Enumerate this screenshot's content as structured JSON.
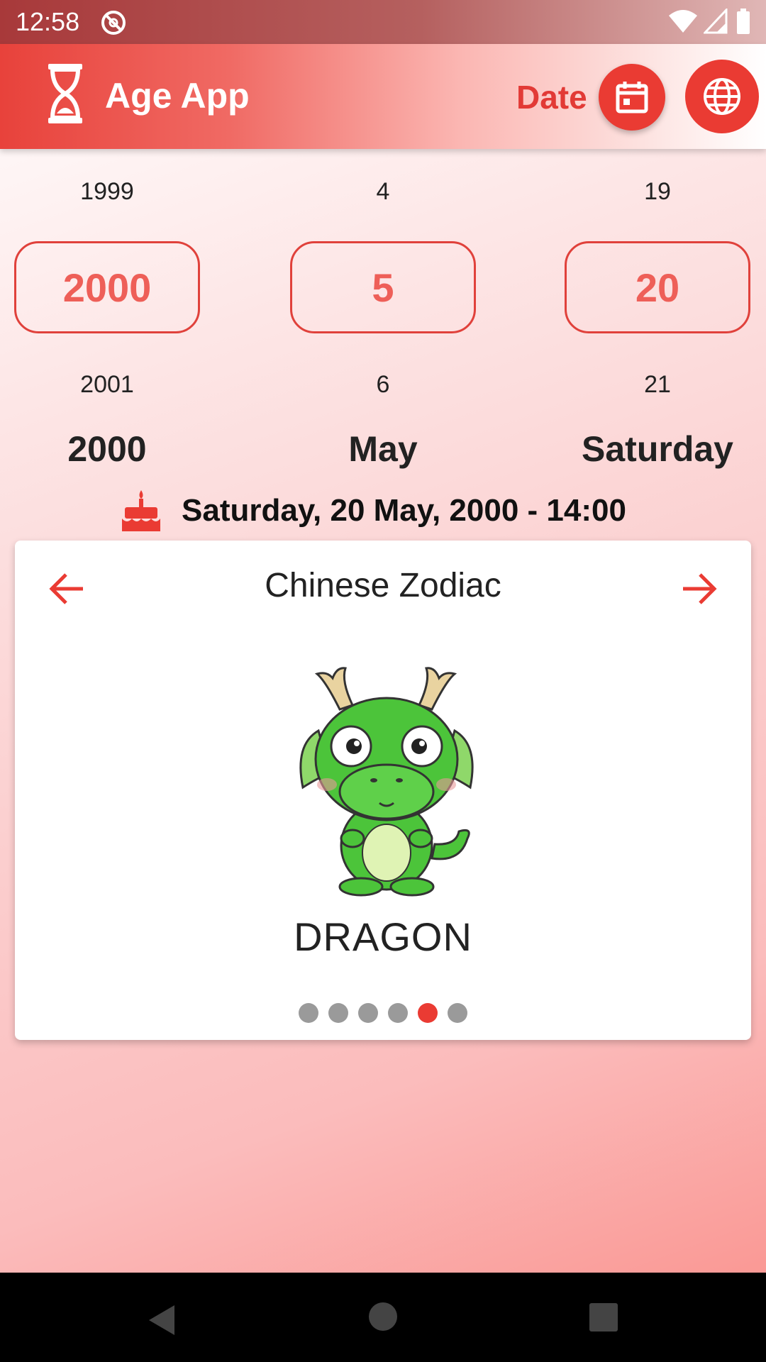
{
  "status": {
    "time": "12:58"
  },
  "app_bar": {
    "title": "Age App",
    "date_label": "Date"
  },
  "pickers": {
    "year": {
      "prev": "1999",
      "selected": "2000",
      "next": "2001"
    },
    "month": {
      "prev": "4",
      "selected": "5",
      "next": "6"
    },
    "day": {
      "prev": "19",
      "selected": "20",
      "next": "21"
    }
  },
  "selection": {
    "year": "2000",
    "month": "May",
    "weekday": "Saturday"
  },
  "birth_datetime": "Saturday, 20 May, 2000 - 14:00",
  "zodiac_card": {
    "title": "Chinese Zodiac",
    "name": "DRAGON",
    "page_count": 6,
    "active_index": 4
  },
  "colors": {
    "accent": "#ea3b33",
    "picker_text": "#ee5f58"
  }
}
